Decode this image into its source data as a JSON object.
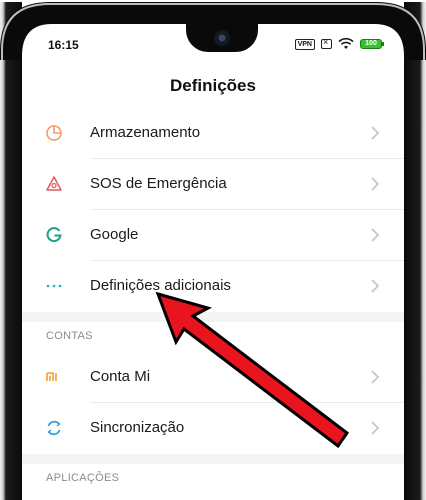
{
  "status_bar": {
    "time": "16:15",
    "vpn": "VPN",
    "battery": "100"
  },
  "header": {
    "title": "Definições"
  },
  "sections": {
    "main": [
      {
        "label": "Armazenamento",
        "icon": "storage-pie-icon",
        "color": "#f39c6b"
      },
      {
        "label": "SOS de Emergência",
        "icon": "sos-triangle-icon",
        "color": "#e05a5a"
      },
      {
        "label": "Google",
        "icon": "google-g-icon",
        "color": "#1aa38a"
      },
      {
        "label": "Definições adicionais",
        "icon": "more-dots-icon",
        "color": "#2aa8c8"
      }
    ],
    "accounts_header": "CONTAS",
    "accounts": [
      {
        "label": "Conta Mi",
        "icon": "mi-logo-icon",
        "color": "#f0a030"
      },
      {
        "label": "Sincronização",
        "icon": "sync-icon",
        "color": "#2a9ad8"
      }
    ],
    "apps_header": "APLICAÇÕES"
  },
  "colors": {
    "arrow_fill": "#e8141e",
    "arrow_outline": "#000000",
    "chevron": "#c4c4c4"
  }
}
